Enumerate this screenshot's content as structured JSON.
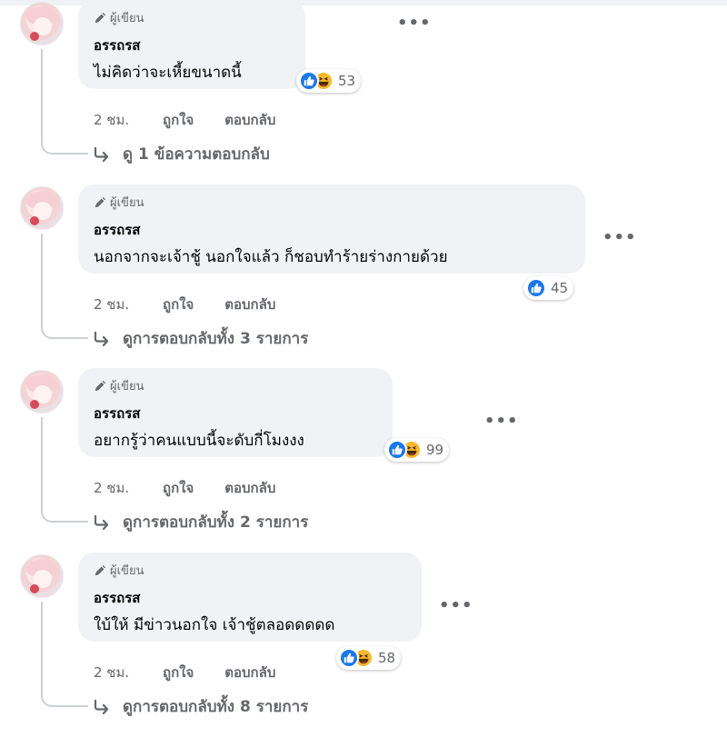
{
  "comments": [
    {
      "badge": "ผู้เขียน",
      "name": "อรรถรส",
      "text": "ไม่คิดว่าจะเหี้ยขนาดนี้",
      "reactions": [
        "like",
        "haha"
      ],
      "reaction_count": "53",
      "time": "2 ชม.",
      "like_label": "ถูกใจ",
      "reply_label": "ตอบกลับ",
      "view_replies": "ดู 1 ข้อความตอบกลับ"
    },
    {
      "badge": "ผู้เขียน",
      "name": "อรรถรส",
      "text": "นอกจากจะเจ้าชู้ นอกใจแล้ว ก็ชอบทำร้ายร่างกายด้วย",
      "reactions": [
        "like"
      ],
      "reaction_count": "45",
      "time": "2 ชม.",
      "like_label": "ถูกใจ",
      "reply_label": "ตอบกลับ",
      "view_replies": "ดูการตอบกลับทั้ง 3 รายการ"
    },
    {
      "badge": "ผู้เขียน",
      "name": "อรรถรส",
      "text": "อยากรู้ว่าคนแบบนี้จะดับกี่โมงงง",
      "reactions": [
        "like",
        "haha"
      ],
      "reaction_count": "99",
      "time": "2 ชม.",
      "like_label": "ถูกใจ",
      "reply_label": "ตอบกลับ",
      "view_replies": "ดูการตอบกลับทั้ง 2 รายการ"
    },
    {
      "badge": "ผู้เขียน",
      "name": "อรรถรส",
      "text": "ใบ้ให้ มีข่าวนอกใจ เจ้าชู้ตลอดดดดด",
      "reactions": [
        "like",
        "haha"
      ],
      "reaction_count": "58",
      "time": "2 ชม.",
      "like_label": "ถูกใจ",
      "reply_label": "ตอบกลับ",
      "view_replies": "ดูการตอบกลับทั้ง 8 รายการ"
    }
  ],
  "icons": {
    "badge": "pencil-icon",
    "more": "more-options-icon",
    "like_reaction": "like-reaction-icon",
    "haha_reaction": "haha-reaction-icon",
    "reply_arrow": "reply-arrow-icon"
  },
  "colors": {
    "bubble": "#f0f2f5",
    "like_blue": "#1877f2",
    "haha_yellow": "#f7b928",
    "secondary_text": "#65676b"
  }
}
